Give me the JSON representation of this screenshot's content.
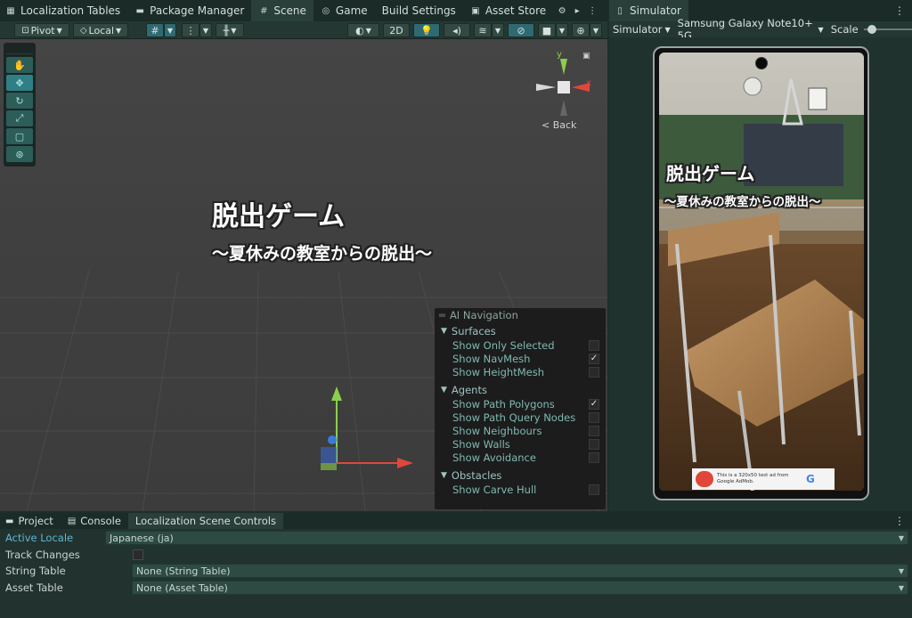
{
  "top_tabs": [
    {
      "label": "Localization Tables",
      "icon": "table-icon"
    },
    {
      "label": "Package Manager",
      "icon": "package-icon"
    },
    {
      "label": "Scene",
      "icon": "grid-icon"
    },
    {
      "label": "Game",
      "icon": "gamepad-icon"
    },
    {
      "label": "Build Settings",
      "icon": ""
    },
    {
      "label": "Asset Store",
      "icon": "store-icon"
    }
  ],
  "simulator_tab": {
    "label": "Simulator"
  },
  "scene_toolbar": {
    "pivot": "Pivot",
    "local": "Local",
    "mode_2d": "2D"
  },
  "gizmo": {
    "y": "y",
    "x": "x",
    "back": "Back"
  },
  "scene_text": {
    "title": "脱出ゲーム",
    "subtitle": "〜夏休みの教室からの脱出〜"
  },
  "ai_navigation": {
    "title": "AI Navigation",
    "sections": [
      {
        "name": "Surfaces",
        "items": [
          {
            "label": "Show Only Selected",
            "checked": false
          },
          {
            "label": "Show NavMesh",
            "checked": true
          },
          {
            "label": "Show HeightMesh",
            "checked": false
          }
        ]
      },
      {
        "name": "Agents",
        "items": [
          {
            "label": "Show Path Polygons",
            "checked": true
          },
          {
            "label": "Show Path Query Nodes",
            "checked": false
          },
          {
            "label": "Show Neighbours",
            "checked": false
          },
          {
            "label": "Show Walls",
            "checked": false
          },
          {
            "label": "Show Avoidance",
            "checked": false
          }
        ]
      },
      {
        "name": "Obstacles",
        "items": [
          {
            "label": "Show Carve Hull",
            "checked": false
          }
        ]
      }
    ]
  },
  "simulator_toolbar": {
    "mode": "Simulator",
    "device": "Samsung Galaxy Note10+ 5G",
    "scale_label": "Scale"
  },
  "phone_screen": {
    "title": "脱出ゲーム",
    "subtitle": "〜夏休みの教室からの脱出〜",
    "ad_text": "This is a 320x50 test ad from Google AdMob."
  },
  "bottom_tabs": [
    {
      "label": "Project",
      "icon": "folder-icon"
    },
    {
      "label": "Console",
      "icon": "console-icon"
    },
    {
      "label": "Localization Scene Controls",
      "icon": ""
    }
  ],
  "localization": {
    "active_locale_label": "Active Locale",
    "active_locale_value": "Japanese (ja)",
    "track_changes_label": "Track Changes",
    "track_changes_checked": false,
    "string_table_label": "String Table",
    "string_table_value": "None (String Table)",
    "asset_table_label": "Asset Table",
    "asset_table_value": "None (Asset Table)"
  }
}
